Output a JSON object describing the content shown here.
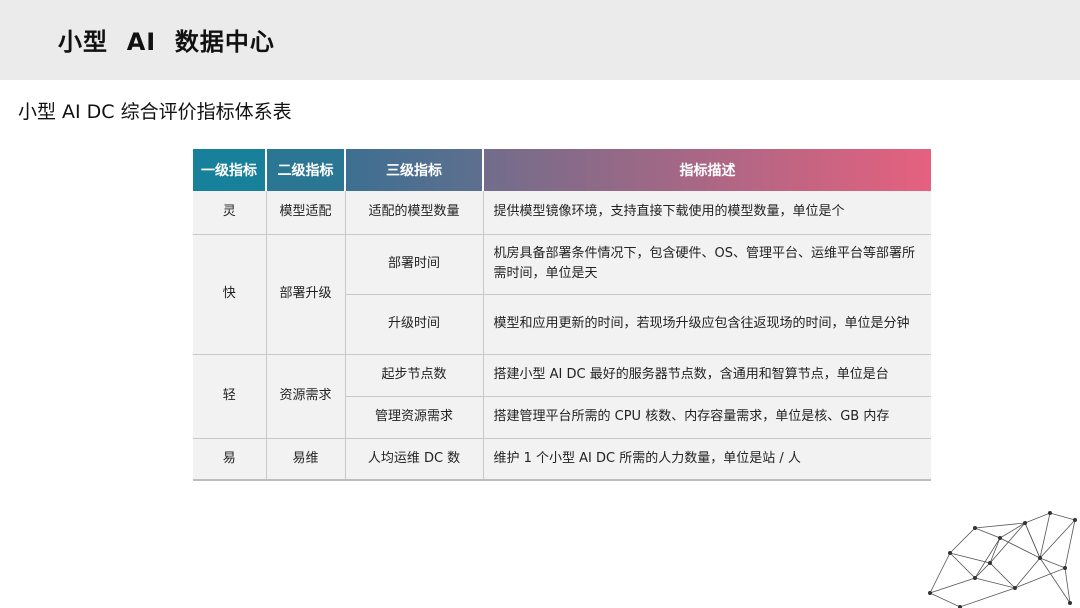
{
  "header": {
    "title": "小型  AI  数据中心"
  },
  "subtitle": "小型 AI DC 综合评价指标体系表",
  "table": {
    "headers": [
      "一级指标",
      "二级指标",
      "三级指标",
      "指标描述"
    ],
    "header_colors": [
      "#1a7f94",
      "#2a7291",
      "#3f6f8e",
      "#b86a8a"
    ],
    "rows": [
      {
        "l1": "灵",
        "l2": "模型适配",
        "l3": "适配的模型数量",
        "desc": "提供模型镜像环境，支持直接下载使用的模型数量，单位是个"
      },
      {
        "l1": "快",
        "l2": "部署升级",
        "l3": "部署时间",
        "desc": "机房具备部署条件情况下，包含硬件、OS、管理平台、运维平台等部署所需时间，单位是天"
      },
      {
        "l3": "升级时间",
        "desc": "模型和应用更新的时间，若现场升级应包含往返现场的时间，单位是分钟"
      },
      {
        "l1": "轻",
        "l2": "资源需求",
        "l3": "起步节点数",
        "desc": "搭建小型 AI DC 最好的服务器节点数，含通用和智算节点，单位是台"
      },
      {
        "l3": "管理资源需求",
        "desc": "搭建管理平台所需的 CPU 核数、内存容量需求，单位是核、GB 内存"
      },
      {
        "l1": "易",
        "l2": "易维",
        "l3": "人均运维 DC 数",
        "desc": "维护 1 个小型 AI DC 所需的人力数量，单位是站 / 人"
      }
    ]
  },
  "decoration": {
    "icon": "network-graph-icon"
  }
}
